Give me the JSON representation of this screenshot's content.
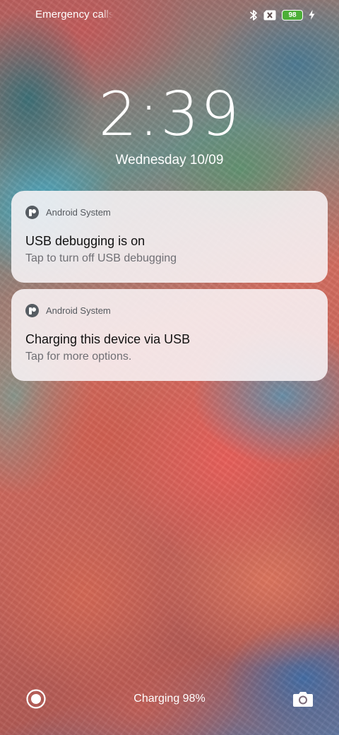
{
  "status_bar": {
    "carrier_text": "Emergency calls",
    "battery_level": "98",
    "icons": [
      "bluetooth-icon",
      "no-sim-icon",
      "battery-icon",
      "charging-bolt-icon"
    ],
    "battery_color": "#4caf38"
  },
  "lockscreen": {
    "time": "2:39",
    "date": "Wednesday 10/09"
  },
  "notifications": [
    {
      "app_name": "Android System",
      "title": "USB debugging is on",
      "body": "Tap to turn off USB debugging"
    },
    {
      "app_name": "Android System",
      "title": "Charging this device via USB",
      "body": "Tap for more options."
    }
  ],
  "bottom_bar": {
    "left_shortcut_icon": "assistant-icon",
    "status_text": "Charging 98%",
    "right_shortcut_icon": "camera-icon"
  }
}
